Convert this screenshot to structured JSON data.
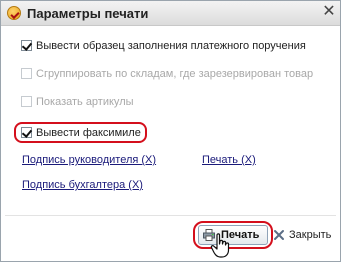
{
  "window": {
    "title": "Параметры печати",
    "close_glyph": "✕"
  },
  "options": [
    {
      "label": "Вывести образец заполнения платежного поручения",
      "checked": true,
      "enabled": true
    },
    {
      "label": "Сгруппировать по складам, где зарезервирован товар",
      "checked": false,
      "enabled": false
    },
    {
      "label": "Показать артикулы",
      "checked": false,
      "enabled": false
    },
    {
      "label": "Вывести факсимиле",
      "checked": true,
      "enabled": true
    }
  ],
  "links": {
    "director_signature": "Подпись руководителя (X)",
    "stamp": "Печать (X)",
    "accountant_signature": "Подпись бухгалтера (X)"
  },
  "buttons": {
    "print": "Печать",
    "close": "Закрыть"
  },
  "colors": {
    "highlight": "#d40f1c",
    "link": "#1a1a7a",
    "disabled_text": "#a8a8a8"
  },
  "icons": {
    "title": "print-settings-icon",
    "print": "printer-icon",
    "close": "close-x-icon",
    "cursor": "hand-pointer-icon"
  }
}
